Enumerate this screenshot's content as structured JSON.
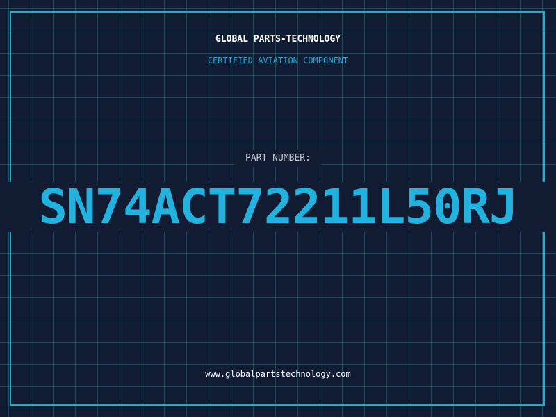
{
  "header": {
    "company": "GLOBAL PARTS-TECHNOLOGY",
    "subtitle": "CERTIFIED AVIATION COMPONENT"
  },
  "part": {
    "label": "PART NUMBER:",
    "number": "SN74ACT72211L50RJ"
  },
  "footer": {
    "url": "www.globalpartstechnology.com"
  },
  "colors": {
    "background": "#111c33",
    "grid": "#3c8296",
    "accent": "#22b2df",
    "text": "#ffffff",
    "label": "#c5cad3"
  }
}
